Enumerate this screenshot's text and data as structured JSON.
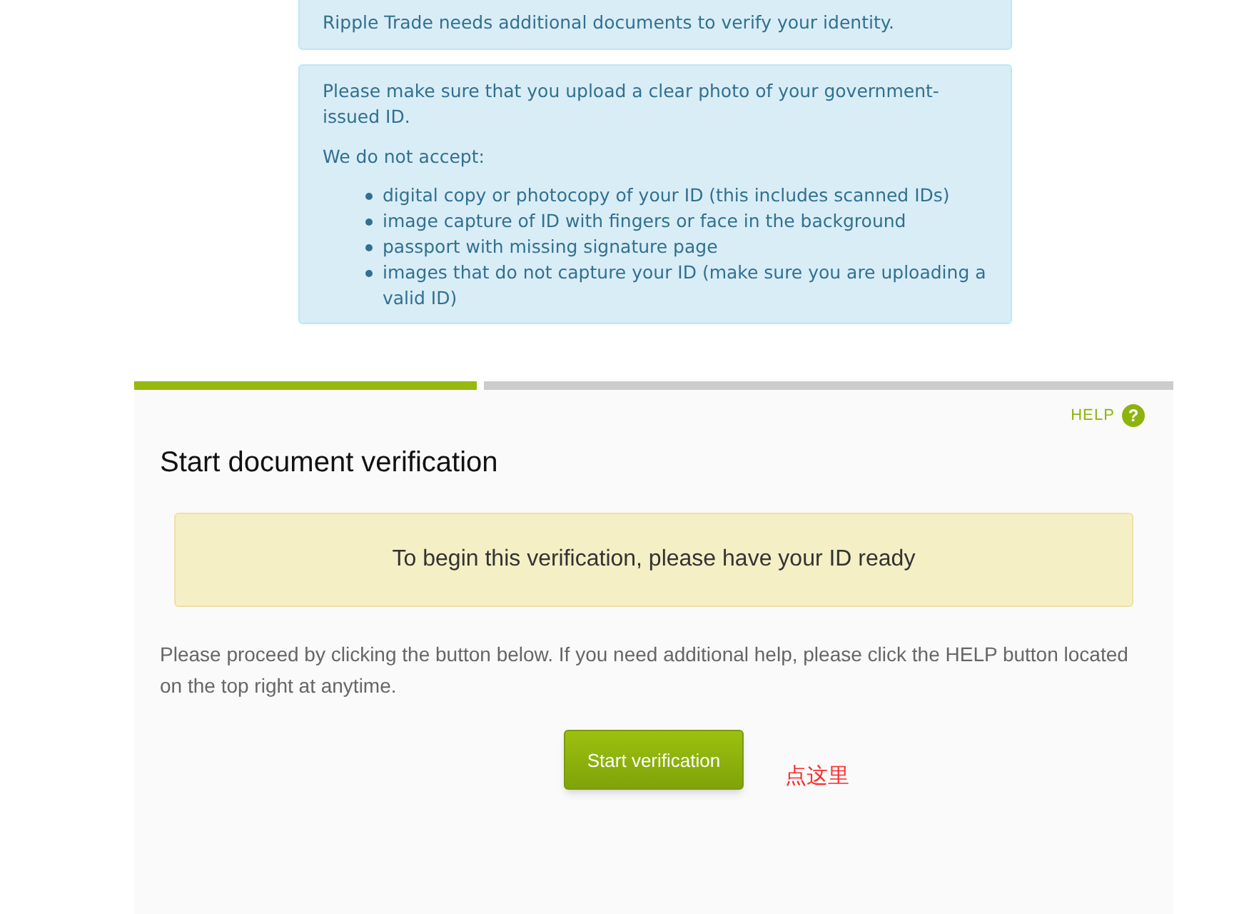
{
  "notice": {
    "text": "Ripple Trade needs additional documents to verify your identity."
  },
  "requirements": {
    "intro": "Please make sure that you upload a clear photo of your government-issued ID.",
    "lead": "We do not accept:",
    "items": [
      "digital copy or photocopy of your ID (this includes scanned IDs)",
      "image capture of ID with fingers or face in the background",
      "passport with missing signature page",
      "images that do not capture your ID (make sure you are uploading a valid ID)"
    ]
  },
  "steps": [
    {
      "done": true
    },
    {
      "done": false
    }
  ],
  "help": {
    "label": "HELP",
    "icon": "?"
  },
  "title": "Start document verification",
  "ready_banner": "To begin this verification, please have your ID ready",
  "instructions": "Please proceed by clicking the button below. If you need additional help, please click the HELP button located on the top right at anytime.",
  "start_button": "Start verification",
  "annotation": "点这里"
}
